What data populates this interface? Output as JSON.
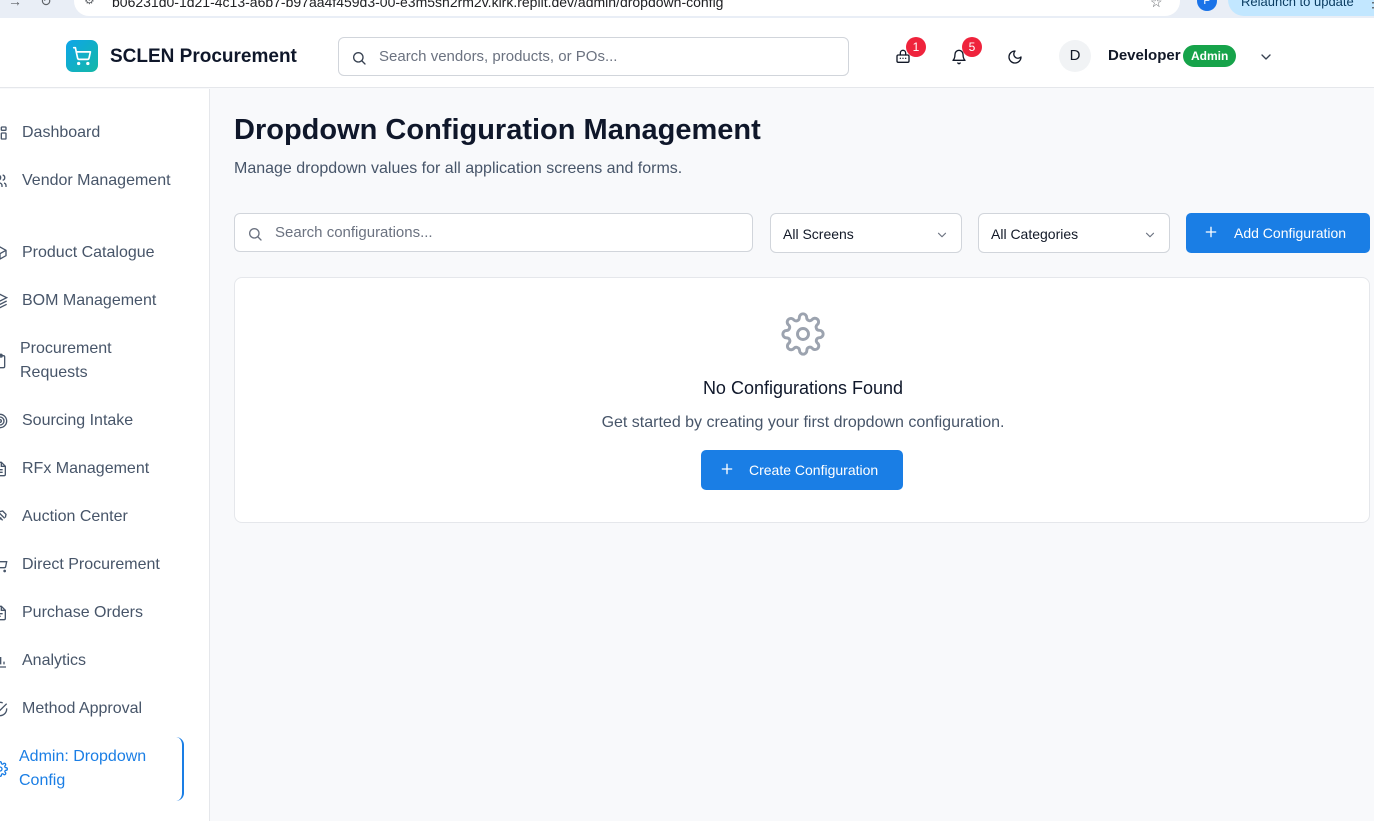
{
  "browser": {
    "url": "b06231d0-1d21-4c13-a6b7-b97aa4f459d3-00-e3m5sh2rm2v.kirk.replit.dev/admin/dropdown-config",
    "profile_initial": "P",
    "relaunch_label": "Relaunch to update"
  },
  "header": {
    "app_title": "SCLEN Procurement",
    "search_placeholder": "Search vendors, products, or POs...",
    "cart_badge": "1",
    "notification_badge": "5",
    "user": {
      "avatar_initial": "D",
      "name": "Developer",
      "role": "Admin"
    }
  },
  "sidebar": {
    "items": [
      {
        "label": "Dashboard",
        "icon": "dashboard-icon",
        "active": false
      },
      {
        "label": "Vendor Management",
        "icon": "users-icon",
        "active": false
      },
      {
        "label": "Product Catalogue",
        "icon": "package-icon",
        "active": false
      },
      {
        "label": "BOM Management",
        "icon": "layers-icon",
        "active": false
      },
      {
        "label": "Procurement Requests",
        "icon": "clipboard-icon",
        "active": false
      },
      {
        "label": "Sourcing Intake",
        "icon": "target-icon",
        "active": false
      },
      {
        "label": "RFx Management",
        "icon": "file-text-icon",
        "active": false
      },
      {
        "label": "Auction Center",
        "icon": "gavel-icon",
        "active": false
      },
      {
        "label": "Direct Procurement",
        "icon": "shopping-cart-icon",
        "active": false
      },
      {
        "label": "Purchase Orders",
        "icon": "file-icon",
        "active": false
      },
      {
        "label": "Analytics",
        "icon": "bar-chart-icon",
        "active": false
      },
      {
        "label": "Method Approval",
        "icon": "check-circle-icon",
        "active": false
      },
      {
        "label": "Admin: Dropdown Config",
        "icon": "settings-icon",
        "active": true
      }
    ]
  },
  "main": {
    "title": "Dropdown Configuration Management",
    "subtitle": "Manage dropdown values for all application screens and forms.",
    "search_placeholder": "Search configurations...",
    "screen_filter": "All Screens",
    "category_filter": "All Categories",
    "add_button": "Add Configuration",
    "empty_state": {
      "title": "No Configurations Found",
      "description": "Get started by creating your first dropdown configuration.",
      "button": "Create Configuration"
    }
  },
  "colors": {
    "accent": "#1a7ee5",
    "badge": "#ef233c",
    "role_badge": "#16a34a",
    "logo_gradient_start": "#0ea5e9",
    "logo_gradient_end": "#14b8a6"
  }
}
